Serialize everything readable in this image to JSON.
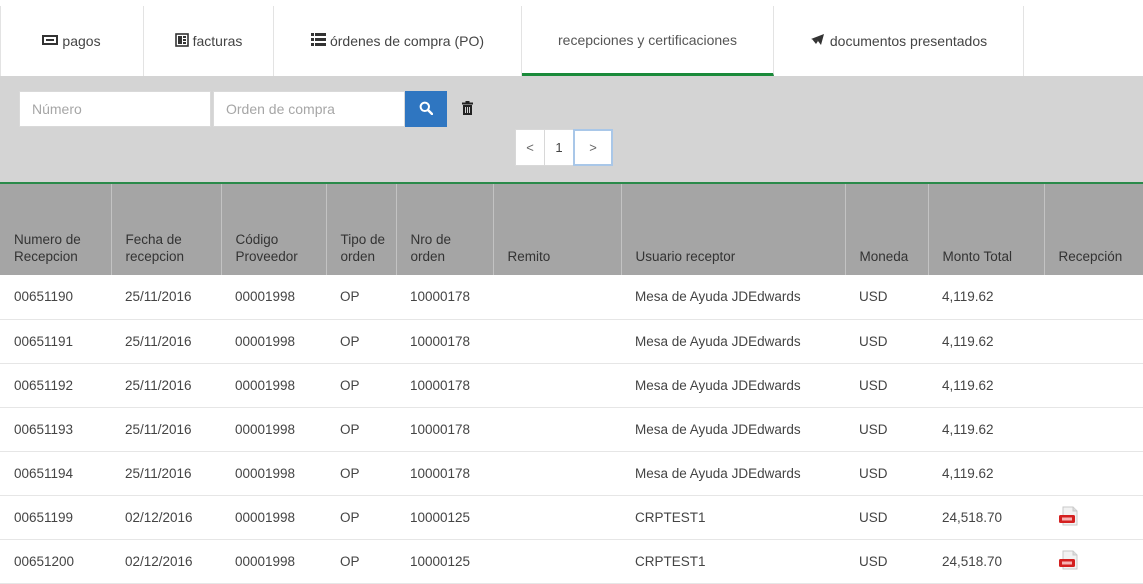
{
  "tabs": [
    {
      "label": "pagos",
      "icon": "money-icon"
    },
    {
      "label": "facturas",
      "icon": "invoice-icon"
    },
    {
      "label": "órdenes de compra (PO)",
      "icon": "list-icon"
    },
    {
      "label": "recepciones y certificaciones",
      "icon": "",
      "active": true
    },
    {
      "label": "documentos presentados",
      "icon": "send-icon"
    }
  ],
  "filter": {
    "numero_placeholder": "Número",
    "orden_placeholder": "Orden de compra",
    "pagination": {
      "prev": "<",
      "current": "1",
      "next": ">"
    }
  },
  "colors": {
    "accent": "#2f76c1",
    "active_tab": "#1a8a3a",
    "header_bg": "#a5a5a5",
    "filter_bg": "#d4d4d4"
  },
  "table": {
    "headers": [
      "Numero de Recepcion",
      "Fecha de recepcion",
      "Código Proveedor",
      "Tipo de orden",
      "Nro de orden",
      "Remito",
      "Usuario receptor",
      "Moneda",
      "Monto Total",
      "Recepción"
    ],
    "rows": [
      {
        "numero": "00651190",
        "fecha": "25/11/2016",
        "proveedor": "00001998",
        "tipo": "OP",
        "orden": "10000178",
        "remito": "",
        "usuario": "Mesa de Ayuda JDEdwards",
        "moneda": "USD",
        "monto": "4,119.62",
        "pdf": false
      },
      {
        "numero": "00651191",
        "fecha": "25/11/2016",
        "proveedor": "00001998",
        "tipo": "OP",
        "orden": "10000178",
        "remito": "",
        "usuario": "Mesa de Ayuda JDEdwards",
        "moneda": "USD",
        "monto": "4,119.62",
        "pdf": false
      },
      {
        "numero": "00651192",
        "fecha": "25/11/2016",
        "proveedor": "00001998",
        "tipo": "OP",
        "orden": "10000178",
        "remito": "",
        "usuario": "Mesa de Ayuda JDEdwards",
        "moneda": "USD",
        "monto": "4,119.62",
        "pdf": false
      },
      {
        "numero": "00651193",
        "fecha": "25/11/2016",
        "proveedor": "00001998",
        "tipo": "OP",
        "orden": "10000178",
        "remito": "",
        "usuario": "Mesa de Ayuda JDEdwards",
        "moneda": "USD",
        "monto": "4,119.62",
        "pdf": false
      },
      {
        "numero": "00651194",
        "fecha": "25/11/2016",
        "proveedor": "00001998",
        "tipo": "OP",
        "orden": "10000178",
        "remito": "",
        "usuario": "Mesa de Ayuda JDEdwards",
        "moneda": "USD",
        "monto": "4,119.62",
        "pdf": false
      },
      {
        "numero": "00651199",
        "fecha": "02/12/2016",
        "proveedor": "00001998",
        "tipo": "OP",
        "orden": "10000125",
        "remito": "",
        "usuario": "CRPTEST1",
        "moneda": "USD",
        "monto": "24,518.70",
        "pdf": true
      },
      {
        "numero": "00651200",
        "fecha": "02/12/2016",
        "proveedor": "00001998",
        "tipo": "OP",
        "orden": "10000125",
        "remito": "",
        "usuario": "CRPTEST1",
        "moneda": "USD",
        "monto": "24,518.70",
        "pdf": true
      }
    ]
  }
}
